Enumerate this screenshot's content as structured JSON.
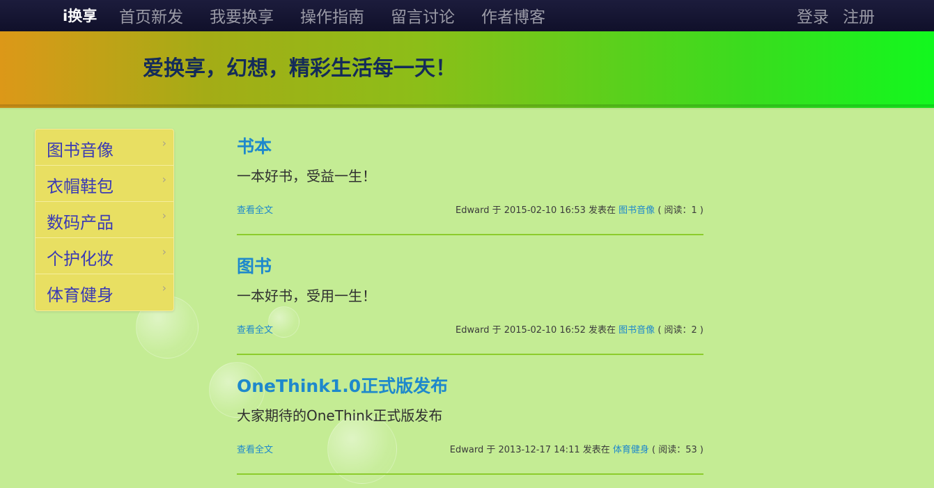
{
  "navbar": {
    "brand": "i换享",
    "links": [
      "首页新发",
      "我要换享",
      "操作指南",
      "留言讨论",
      "作者博客"
    ],
    "login": "登录",
    "register": "注册"
  },
  "banner": {
    "slogan": "爱换享，幻想，精彩生活每一天！"
  },
  "sidebar": {
    "items": [
      {
        "label": "图书音像",
        "chevron": "›"
      },
      {
        "label": "衣帽鞋包",
        "chevron": "›"
      },
      {
        "label": "数码产品",
        "chevron": "›"
      },
      {
        "label": "个护化妆",
        "chevron": "›"
      },
      {
        "label": "体育健身",
        "chevron": "›"
      }
    ]
  },
  "posts": [
    {
      "title": "书本",
      "summary": "一本好书，受益一生！",
      "more": "查看全文",
      "meta_prefix": "Edward 于 2015-02-10 16:53 发表在",
      "category": "图书音像",
      "meta_suffix": "( 阅读：1 )"
    },
    {
      "title": "图书",
      "summary": "一本好书，受用一生！",
      "more": "查看全文",
      "meta_prefix": "Edward 于 2015-02-10 16:52 发表在",
      "category": "图书音像",
      "meta_suffix": "( 阅读：2 )"
    },
    {
      "title": "OneThink1.0正式版发布",
      "summary": "大家期待的OneThink正式版发布",
      "more": "查看全文",
      "meta_prefix": "Edward 于 2013-12-17 14:11 发表在",
      "category": "体育健身",
      "meta_suffix": "( 阅读：53 )"
    }
  ],
  "colors": {
    "navbar_bg": "#14142e",
    "link_blue": "#1e88cc",
    "sidebar_bg": "#e8df62",
    "sidebar_text": "#3a3ab4",
    "divider": "#8ccc2c",
    "page_bg": "#c4ec94",
    "slogan": "#142b59"
  }
}
